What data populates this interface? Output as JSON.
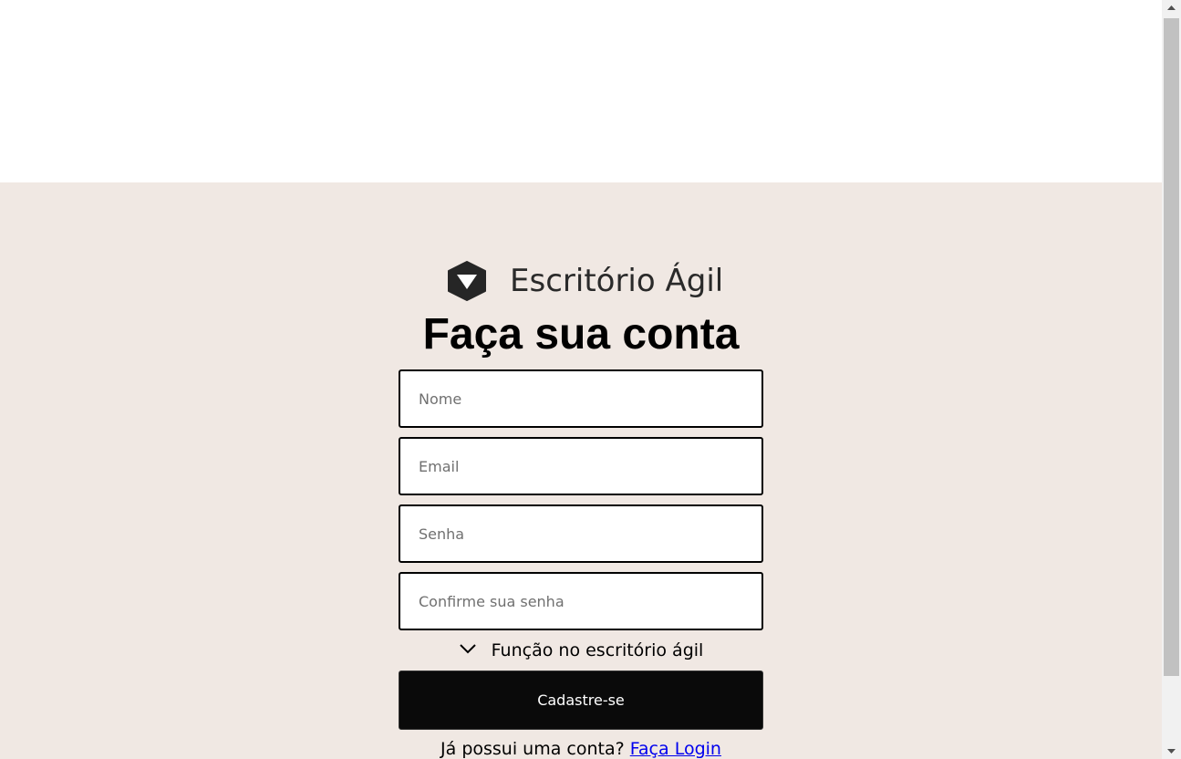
{
  "brand": {
    "name": "Escritório Ágil",
    "logo_icon": "shield-chevron-icon"
  },
  "form": {
    "title": "Faça sua conta",
    "name_placeholder": "Nome",
    "email_placeholder": "Email",
    "password_placeholder": "Senha",
    "confirm_placeholder": "Confirme sua senha",
    "role_select_label": "Função no escritório ágil",
    "submit_label": "Cadastre-se",
    "login_prompt": "Já possui uma conta?",
    "login_link": "Faça Login"
  },
  "colors": {
    "background": "#f0e8e3",
    "button": "#0a0a0a",
    "link": "#0000ee"
  }
}
